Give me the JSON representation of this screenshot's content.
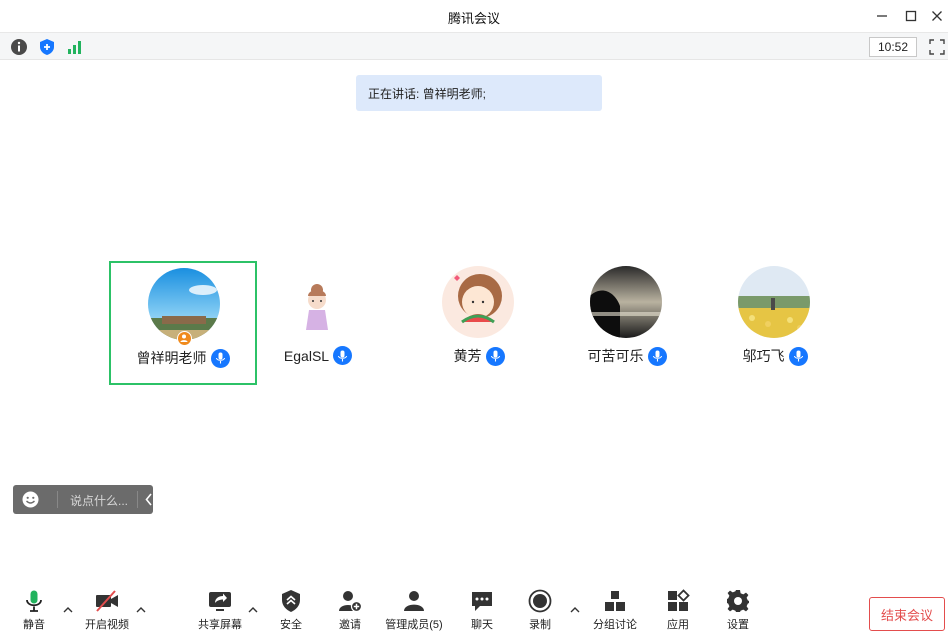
{
  "window": {
    "title": "腾讯会议"
  },
  "infobar": {
    "clock": "10:52"
  },
  "speaking": {
    "label": "正在讲话: 曾祥明老师;"
  },
  "participants": [
    {
      "name": "曾祥明老师"
    },
    {
      "name": "EgalSL"
    },
    {
      "name": "黄芳"
    },
    {
      "name": "可苦可乐"
    },
    {
      "name": "邬巧飞"
    }
  ],
  "chat": {
    "placeholder": "说点什么..."
  },
  "toolbar": {
    "mute": "静音",
    "video": "开启视频",
    "share": "共享屏幕",
    "security": "安全",
    "invite": "邀请",
    "members": "管理成员(5)",
    "chat": "聊天",
    "record": "录制",
    "breakout": "分组讨论",
    "apps": "应用",
    "settings": "设置",
    "end": "结束会议"
  },
  "colors": {
    "accent_blue": "#1677ff",
    "active_border": "#2cc267",
    "end_red": "#e34d4d",
    "mic_green": "#22b35e"
  }
}
